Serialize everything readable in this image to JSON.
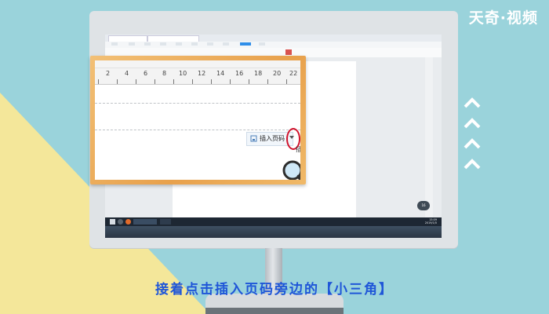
{
  "watermark": "天奇·视频",
  "caption": "接着点击插入页码旁边的【小三角】",
  "zoom_panel": {
    "ruler_numbers": [
      "2",
      "4",
      "6",
      "8",
      "10",
      "12",
      "14",
      "16",
      "18",
      "20",
      "22"
    ],
    "insert_page_number_label": "插入页码",
    "cut_off_text": "插"
  },
  "screen": {
    "zoom_widget": "16",
    "tray_time": "15:09",
    "tray_date": "2019/1/5"
  },
  "colors": {
    "caption": "#1f56d8",
    "background": "#9ad3db",
    "yellow_band": "#f4e79a",
    "highlight_ring": "#d0112b",
    "frame": "#e8a14c"
  }
}
